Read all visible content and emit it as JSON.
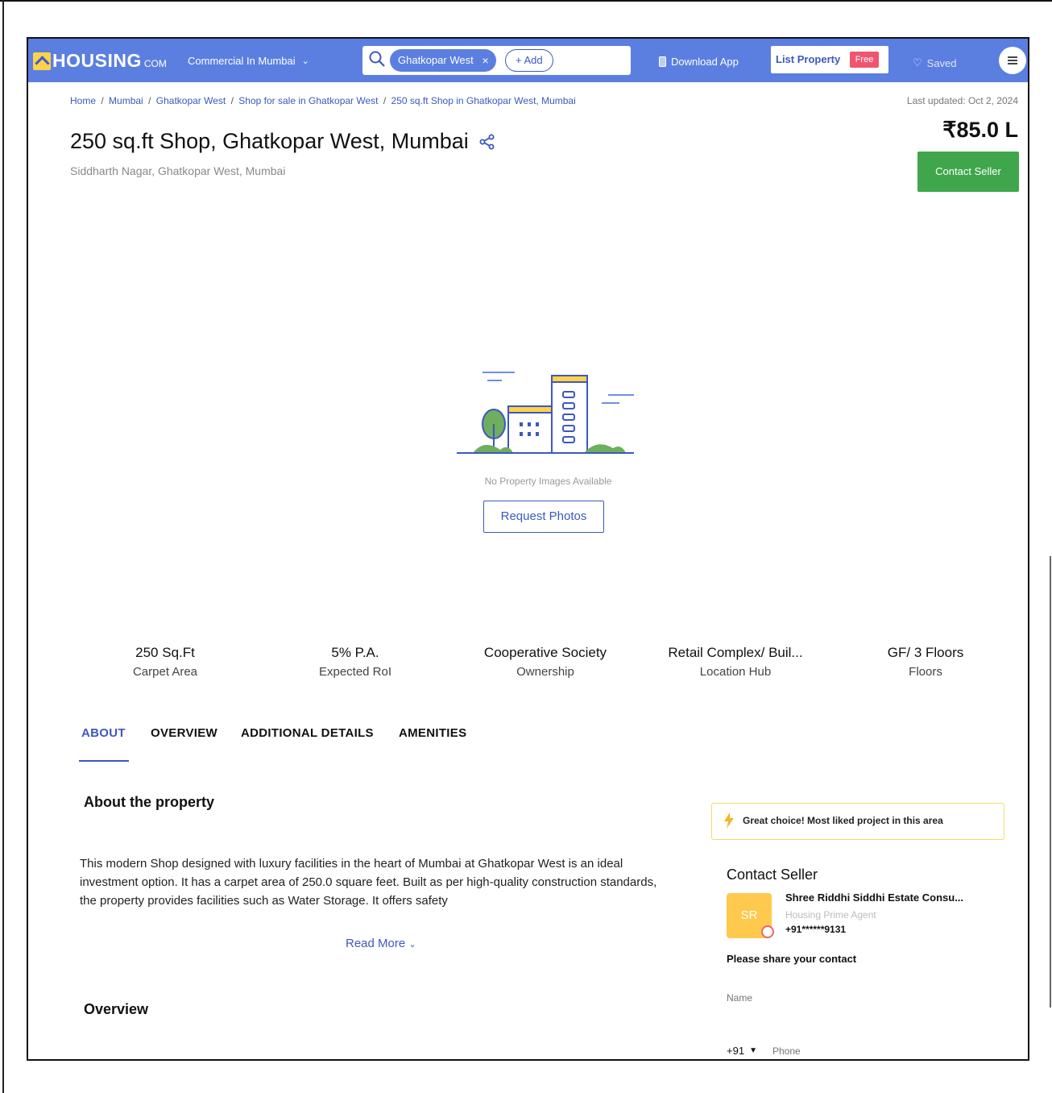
{
  "header": {
    "logo_text": "HOUSING",
    "logo_suffix": "COM",
    "category_label": "Commercial In Mumbai",
    "search": {
      "chip_label": "Ghatkopar West",
      "add_label": "+ Add"
    },
    "download_app_label": "Download App",
    "list_property_label": "List Property",
    "free_tag": "Free",
    "saved_label": "Saved"
  },
  "breadcrumb": {
    "items": [
      "Home",
      "Mumbai",
      "Ghatkopar West",
      "Shop for sale in Ghatkopar West",
      "250 sq.ft Shop in Ghatkopar West, Mumbai"
    ],
    "separator": "/"
  },
  "last_updated": "Last updated: Oct 2, 2024",
  "listing": {
    "title": "250 sq.ft Shop, Ghatkopar West, Mumbai",
    "subtitle": "Siddharth Nagar, Ghatkopar West, Mumbai",
    "price": "₹85.0 L",
    "contact_button": "Contact Seller"
  },
  "gallery": {
    "empty_message": "No Property Images Available",
    "request_button": "Request Photos"
  },
  "stats": [
    {
      "value": "250 Sq.Ft",
      "label": "Carpet Area"
    },
    {
      "value": "5% P.A.",
      "label": "Expected RoI"
    },
    {
      "value": "Cooperative Society",
      "label": "Ownership"
    },
    {
      "value": "Retail Complex/ Buil...",
      "label": "Location Hub"
    },
    {
      "value": "GF/ 3 Floors",
      "label": "Floors"
    }
  ],
  "tabs": [
    "ABOUT",
    "OVERVIEW",
    "ADDITIONAL DETAILS",
    "AMENITIES"
  ],
  "about": {
    "heading": "About the property",
    "text": "This modern Shop designed with luxury facilities in the heart of Mumbai at Ghatkopar West is an ideal investment option. It has a carpet area of 250.0 square feet. Built as per high-quality construction standards, the property provides facilities such as Water Storage. It offers safety",
    "read_more": "Read More"
  },
  "overview_heading": "Overview",
  "sidebar": {
    "great_choice": "Great choice! Most liked project in this area",
    "contact_heading": "Contact Seller",
    "avatar_initials": "SR",
    "agent_name": "Shree Riddhi Siddhi Estate Consu...",
    "agent_role": "Housing Prime Agent",
    "agent_phone": "+91******9131",
    "share_prompt": "Please share your contact",
    "name_placeholder": "Name",
    "country_code": "+91",
    "phone_placeholder": "Phone"
  },
  "colors": {
    "brand_blue": "#5b7fe0",
    "link_blue": "#3c58c0",
    "contact_green": "#3fa64b",
    "free_pink": "#f05570",
    "logo_yellow": "#ffd24a"
  }
}
